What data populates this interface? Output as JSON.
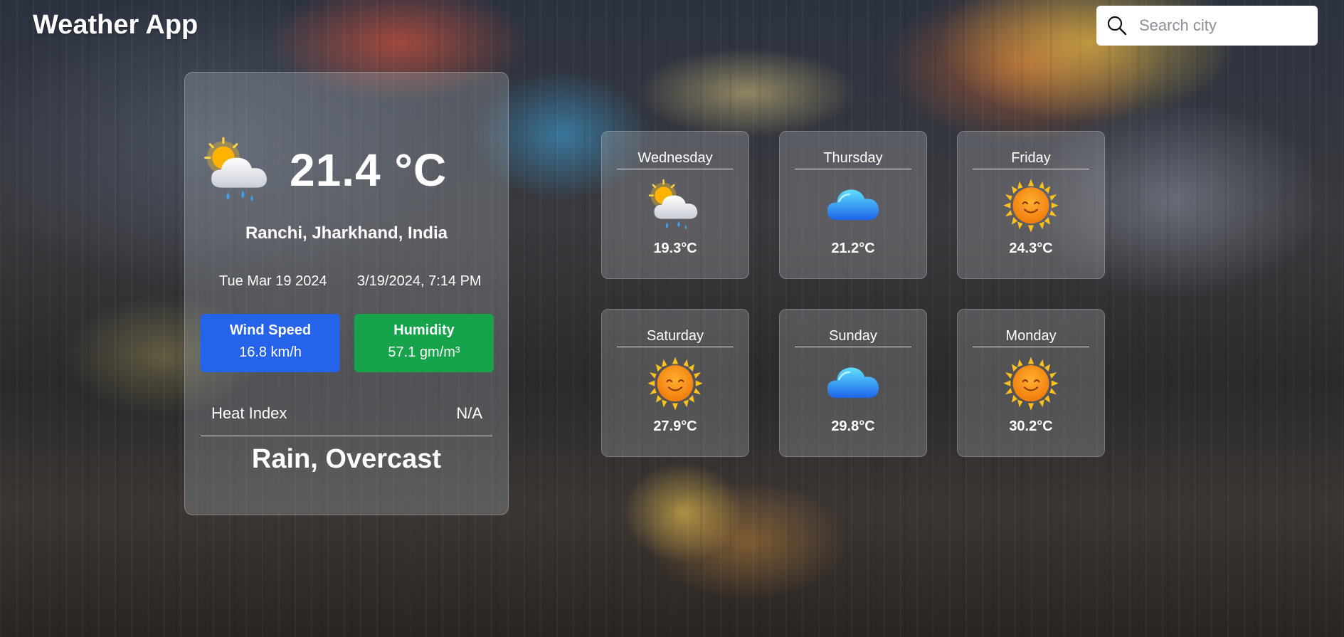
{
  "app": {
    "title": "Weather App"
  },
  "search": {
    "placeholder": "Search city",
    "value": ""
  },
  "current": {
    "icon": "sun-behind-rain-cloud-icon",
    "temperature": "21.4 °C",
    "location": "Ranchi, Jharkhand, India",
    "date": "Tue Mar 19 2024",
    "datetime": "3/19/2024, 7:14 PM",
    "wind": {
      "label": "Wind Speed",
      "value": "16.8 km/h",
      "color": "#2563eb"
    },
    "humidity": {
      "label": "Humidity",
      "value": "57.1 gm/m³",
      "color": "#16a34a"
    },
    "heat_index": {
      "label": "Heat Index",
      "value": "N/A"
    },
    "condition": "Rain, Overcast"
  },
  "forecast": [
    {
      "day": "Wednesday",
      "temp": "19.3°C",
      "icon": "sun-behind-rain-cloud-icon"
    },
    {
      "day": "Thursday",
      "temp": "21.2°C",
      "icon": "cloud-icon"
    },
    {
      "day": "Friday",
      "temp": "24.3°C",
      "icon": "smiling-sun-icon"
    },
    {
      "day": "Saturday",
      "temp": "27.9°C",
      "icon": "smiling-sun-icon"
    },
    {
      "day": "Sunday",
      "temp": "29.8°C",
      "icon": "cloud-icon"
    },
    {
      "day": "Monday",
      "temp": "30.2°C",
      "icon": "smiling-sun-icon"
    }
  ]
}
